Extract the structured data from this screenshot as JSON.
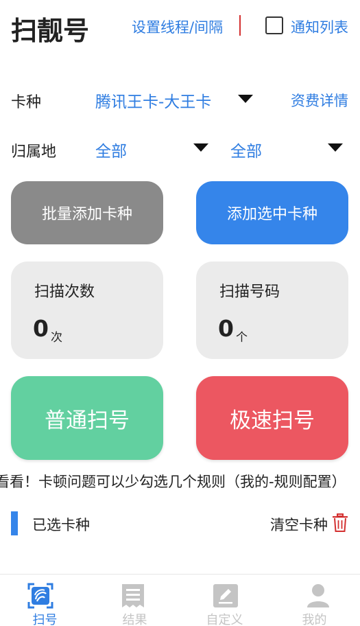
{
  "header": {
    "title": "扫靓号",
    "settings_link": "设置线程/间隔",
    "notify_label": "通知列表",
    "notify_checked": false
  },
  "card_type": {
    "label": "卡种",
    "selected": "腾讯王卡-大王卡",
    "fee_link": "资费详情"
  },
  "location": {
    "label": "归属地",
    "province": "全部",
    "city": "全部"
  },
  "actions": {
    "batch_add": "批量添加卡种",
    "add_selected": "添加选中卡种"
  },
  "stats": {
    "scan_count_label": "扫描次数",
    "scan_count_value": "0",
    "scan_count_unit": "次",
    "scan_numbers_label": "扫描号码",
    "scan_numbers_value": "0",
    "scan_numbers_unit": "个"
  },
  "scan": {
    "normal": "普通扫号",
    "fast": "极速扫号"
  },
  "notice": "看看！卡顿问题可以少勾选几个规则（我的-规则配置）",
  "selected_section": {
    "title": "已选卡种",
    "clear": "清空卡种"
  },
  "colors": {
    "accent": "#2f7de1",
    "gray_button": "#8a8a8a",
    "green": "#62d0a0",
    "red": "#ec5761"
  },
  "nav": {
    "items": [
      {
        "label": "扫号",
        "icon": "scan-icon",
        "active": true
      },
      {
        "label": "结果",
        "icon": "receipt-icon",
        "active": false
      },
      {
        "label": "自定义",
        "icon": "edit-icon",
        "active": false
      },
      {
        "label": "我的",
        "icon": "user-icon",
        "active": false
      }
    ]
  }
}
